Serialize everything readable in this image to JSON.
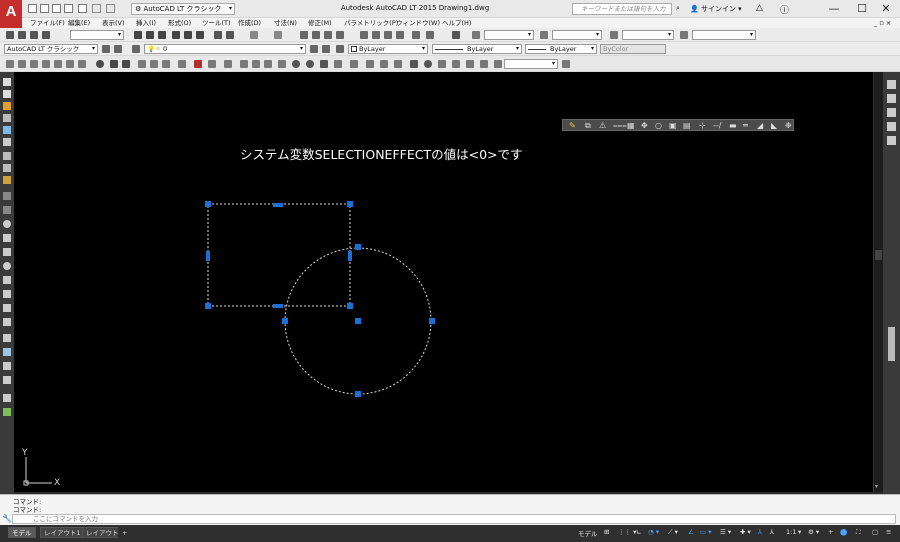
{
  "window": {
    "title": "Autodesk AutoCAD LT 2015    Drawing1.dwg",
    "logo_letter": "A",
    "workspace": "AutoCAD LT クラシック",
    "search_placeholder": "キーワードまたは語句を入力",
    "signin": "サインイン",
    "minimize": "—",
    "maximize": "☐",
    "close": "✕"
  },
  "menu": {
    "items": [
      "ファイル(F)",
      "編集(E)",
      "表示(V)",
      "挿入(I)",
      "形式(O)",
      "ツール(T)",
      "作成(D)",
      "寸法(N)",
      "修正(M)",
      "パラメトリック(P)",
      "ウィンドウ(W)",
      "ヘルプ(H)"
    ],
    "doc_controls": "_ ▫ ×"
  },
  "toolbars": {
    "workspace_combo": "AutoCAD LT クラシック",
    "layer_value": "0",
    "color_value": "ByLayer",
    "linetype_value": "ByLayer",
    "lineweight_value": "ByLayer",
    "plotstyle_value": "ByColor"
  },
  "canvas": {
    "background": "#000000",
    "annotation": "システム変数SELECTIONEFFECTの値は<0>です",
    "grip_color": "#1c6fd6",
    "ucs_x_label": "X",
    "ucs_y_label": "Y"
  },
  "command": {
    "history": [
      "コマンド:",
      "コマンド:"
    ],
    "input_placeholder": "ここにコマンドを入力"
  },
  "status": {
    "tabs": [
      "モデル",
      "レイアウト1",
      "レイアウト2"
    ],
    "add_tab": "+",
    "model_label": "モデル",
    "scale": "1:1"
  }
}
